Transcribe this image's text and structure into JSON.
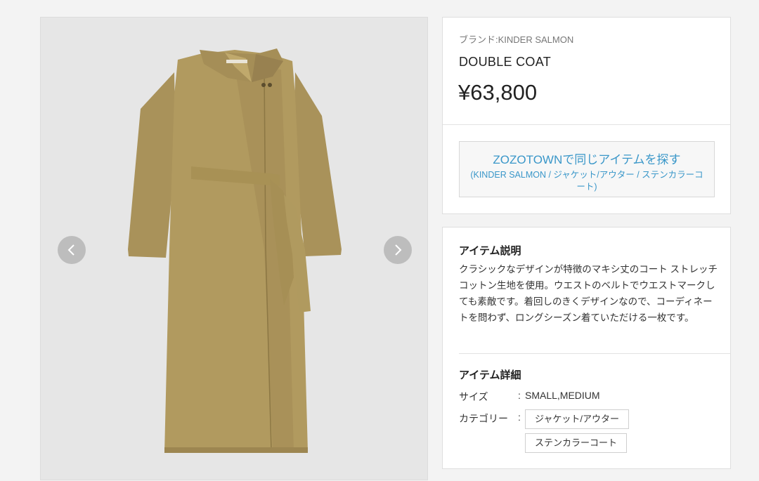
{
  "product": {
    "brand_label": "ブランド:KINDER SALMON",
    "name": "DOUBLE COAT",
    "price": "¥63,800"
  },
  "zozo_button": {
    "title": "ZOZOTOWNで同じアイテムを探す",
    "subtitle": "(KINDER SALMON / ジャケット/アウター / ステンカラーコート)"
  },
  "description": {
    "heading": "アイテム説明",
    "text": "クラシックなデザインが特徴のマキシ丈のコート ストレッチコットン生地を使用。ウエストのベルトでウエストマークしても素敵です。着回しのきくデザインなので、コーディネートを問わず、ロングシーズン着ていただける一枚です。"
  },
  "details": {
    "heading": "アイテム詳細",
    "size_label": "サイズ",
    "size_value": "SMALL,MEDIUM",
    "category_label": "カテゴリー",
    "colon": ":",
    "categories": [
      "ジャケット/アウター",
      "ステンカラーコート"
    ]
  },
  "icons": {
    "prev": "chevron-left-icon",
    "next": "chevron-right-icon"
  },
  "colors": {
    "accent": "#3a97c9",
    "coat": "#b19a5f"
  }
}
